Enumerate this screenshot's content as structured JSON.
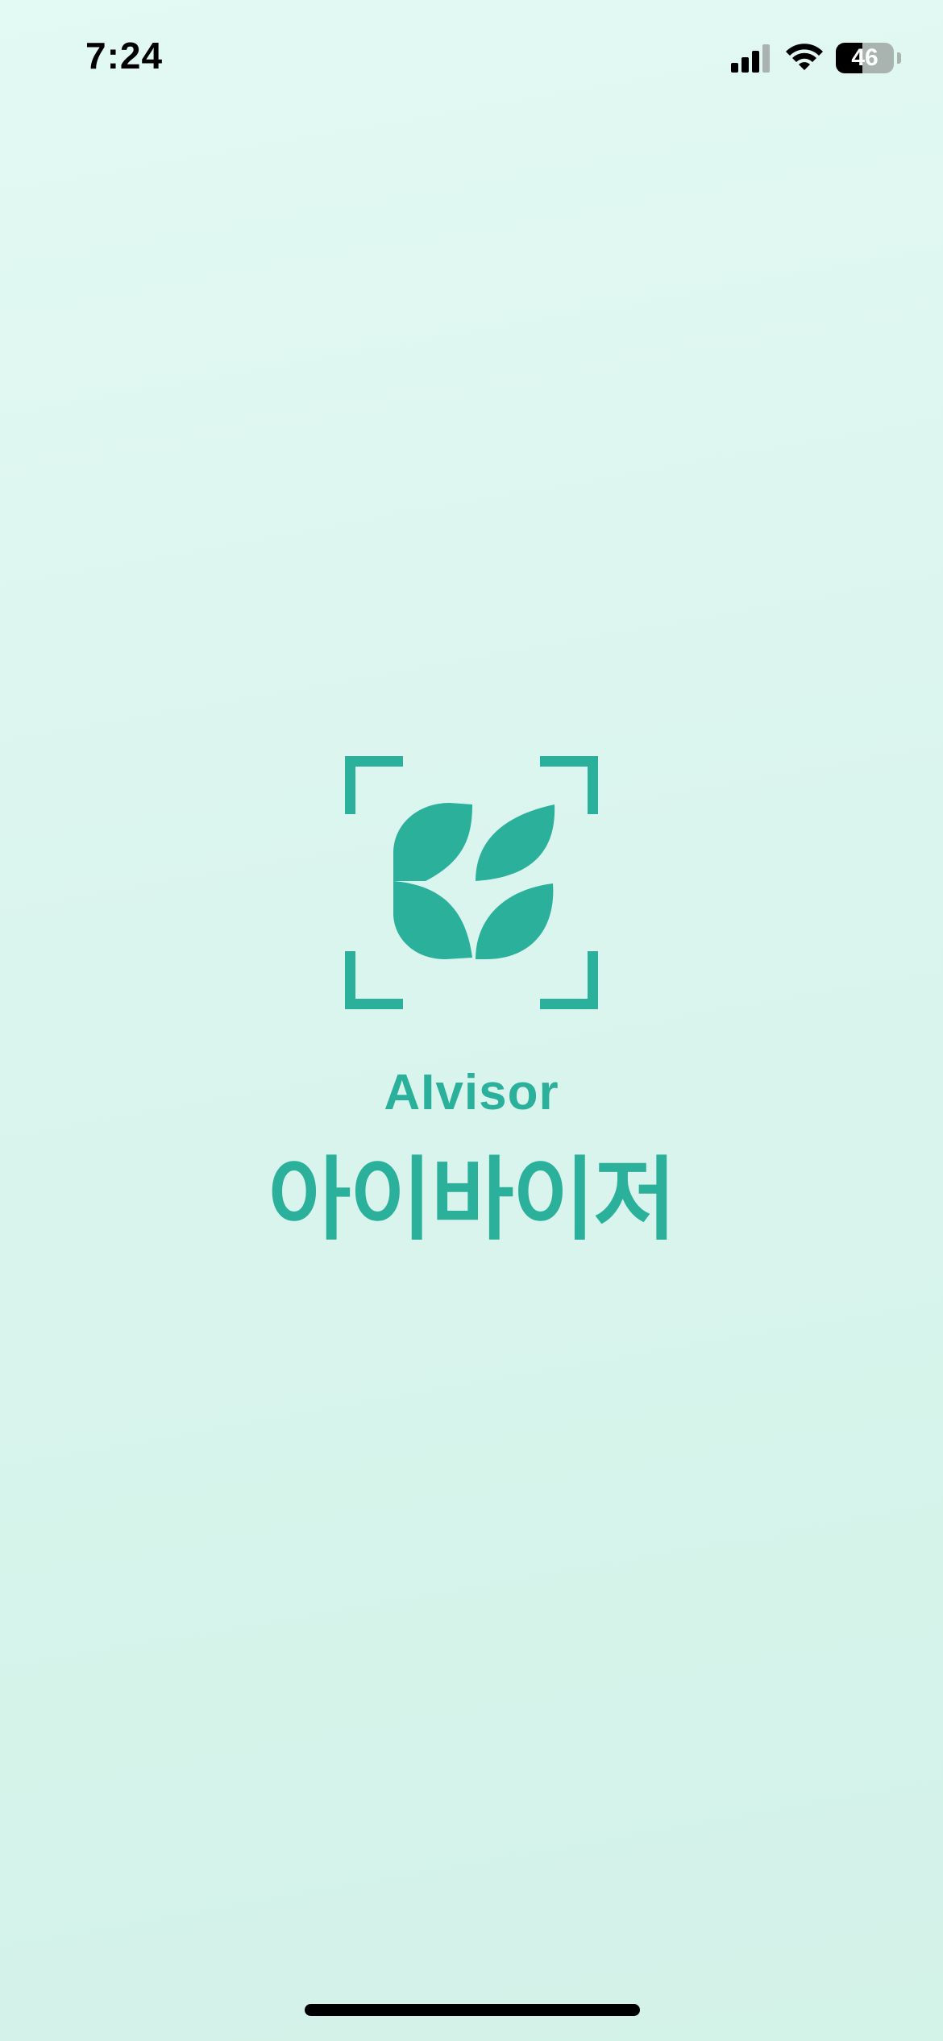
{
  "status_bar": {
    "time": "7:24",
    "battery_level": "46",
    "battery_fraction": 0.46,
    "icons": [
      "signal-icon",
      "wifi-icon",
      "battery-icon"
    ]
  },
  "logo": {
    "icon": "leaf-frame-logo-icon",
    "color": "#2bb09b"
  },
  "brand": {
    "name_en": "AIvisor",
    "name_ko": "아이바이저"
  },
  "colors": {
    "accent": "#2bb09b",
    "background_top": "#e3f9f3",
    "background_bottom": "#d3f2e8"
  }
}
